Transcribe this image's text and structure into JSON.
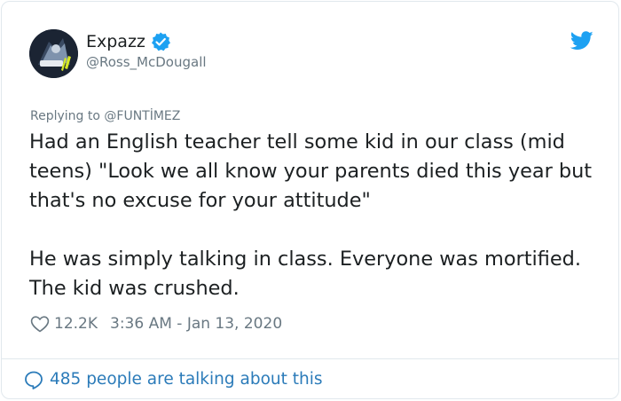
{
  "author": {
    "display_name": "Expazz",
    "handle": "@Ross_McDougall",
    "verified_icon": "verified-badge-icon",
    "avatar_icon": "team-logo-avatar"
  },
  "header": {
    "brand_icon": "twitter-bird-icon"
  },
  "reply": {
    "prefix": "Replying to ",
    "mention": "@FUNTİMEZ"
  },
  "tweet": {
    "text": "Had an English teacher tell some kid in our class (mid teens) \"Look we all know your parents died this year but that's no excuse for your attitude\"\n\nHe was simply talking in class. Everyone was mortified. The kid was crushed."
  },
  "meta": {
    "like_icon": "heart-icon",
    "likes": "12.2K",
    "timestamp": "3:36 AM - Jan 13, 2020"
  },
  "footer": {
    "talking_icon": "speech-bubble-icon",
    "talking_text": "485 people are talking about this"
  },
  "colors": {
    "accent": "#1da1f2",
    "link": "#2b7bb9",
    "muted": "#697882",
    "text": "#1c2022",
    "border": "#e1e8ed"
  }
}
